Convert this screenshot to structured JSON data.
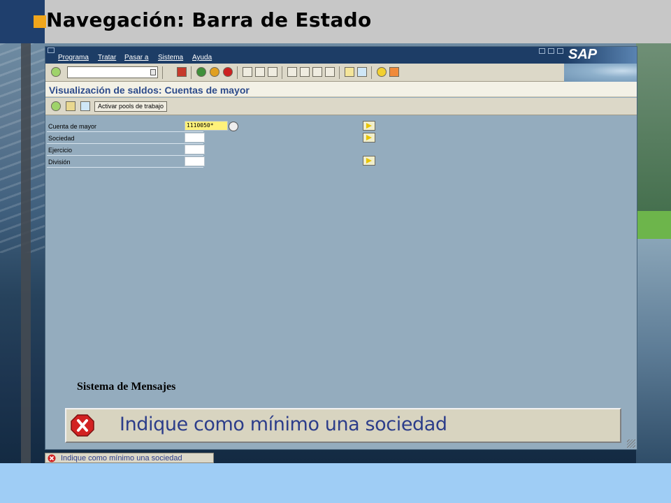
{
  "slide": {
    "title": "Navegación: Barra de Estado"
  },
  "menubar": {
    "items": [
      "Programa",
      "Tratar",
      "Pasar a",
      "Sistema",
      "Ayuda"
    ],
    "logo": "SAP"
  },
  "transaction": {
    "title": "Visualización de saldos: Cuentas de mayor"
  },
  "app_toolbar": {
    "activar_label": "Activar pools de trabajo"
  },
  "form": {
    "fields": [
      {
        "label": "Cuenta de mayor",
        "value": "1110050*"
      },
      {
        "label": "Sociedad",
        "value": ""
      },
      {
        "label": "Ejercicio",
        "value": ""
      },
      {
        "label": "División",
        "value": ""
      }
    ]
  },
  "messages": {
    "system_label": "Sistema de Mensajes",
    "error_text": "Indique como mínimo una sociedad"
  },
  "status_bar": {
    "text": "Indique como mínimo una sociedad"
  },
  "colors": {
    "accent": "#f0a61c",
    "menubar": "#1d3d66",
    "error": "#d22222",
    "title_blue": "#2c4a8a"
  }
}
